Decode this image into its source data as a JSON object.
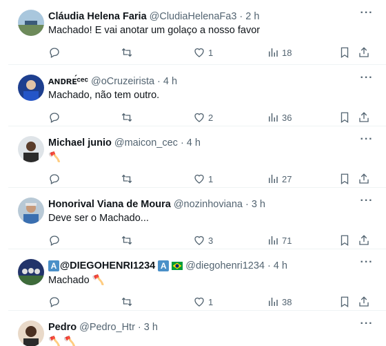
{
  "posts": [
    {
      "name": "Cláudia Helena Faria",
      "handle": "@CludiaHelenaFa3",
      "dot": "·",
      "time": "2 h",
      "text": "Machado! E vai anotar um golaço a nosso favor",
      "likes": "1",
      "views": "18"
    },
    {
      "name": "ᴀɴᴅʀᴇ́ᶜᵉᶜ",
      "handle": "@oCruzeirista",
      "dot": "·",
      "time": "4 h",
      "text": "Machado, não tem outro.",
      "likes": "2",
      "views": "36"
    },
    {
      "name": "Michael junio",
      "handle": "@maicon_cec",
      "dot": "·",
      "time": "4 h",
      "text": "🪓",
      "likes": "1",
      "views": "27"
    },
    {
      "name": "Honorival Viana de Moura",
      "handle": "@nozinhoviana",
      "dot": "·",
      "time": "3 h",
      "text": "Deve ser o Machado...",
      "likes": "3",
      "views": "71"
    },
    {
      "name_badge_left": "A",
      "name": "@DIEGOHENRI1234",
      "name_badge_right": "A",
      "handle": "@diegohenri1234",
      "dot": "·",
      "time": "4 h",
      "text": "Machado 🪓",
      "likes": "1",
      "views": "38"
    },
    {
      "name": "Pedro",
      "handle": "@Pedro_Htr",
      "dot": "·",
      "time": "3 h",
      "text": "🪓 🪓"
    }
  ],
  "icons": {
    "more": "more-icon",
    "reply": "reply-icon",
    "retweet": "retweet-icon",
    "like": "heart-icon",
    "views": "views-icon",
    "bookmark": "bookmark-icon",
    "share": "share-icon"
  },
  "colors": {
    "text": "#0f1419",
    "muted": "#536471",
    "divider": "#eff3f4",
    "badge": "#4a90c8"
  }
}
